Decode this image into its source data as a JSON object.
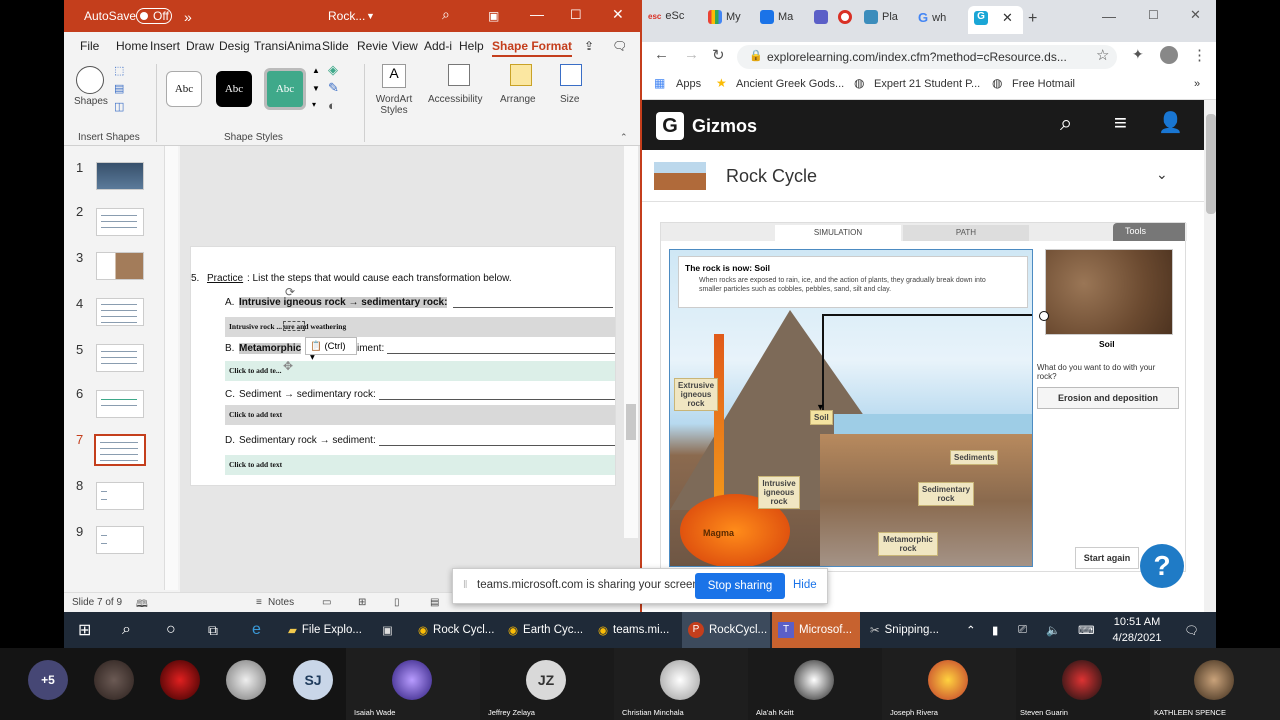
{
  "ppt": {
    "autosave": "AutoSave",
    "autosave_state": "Off",
    "title": "Rock...",
    "tabs": [
      "File",
      "Home",
      "Insert",
      "Draw",
      "Desig",
      "Transi",
      "Anima",
      "Slide",
      "Revie",
      "View",
      "Add-i",
      "Help",
      "Shape Format"
    ],
    "ribbon": {
      "shapes": "Shapes",
      "insert_shapes": "Insert Shapes",
      "style_text": "Abc",
      "shape_styles": "Shape Styles",
      "wordart": "WordArt Styles",
      "accessibility": "Accessibility",
      "arrange": "Arrange",
      "size": "Size"
    },
    "slide_numbers": [
      "1",
      "2",
      "3",
      "4",
      "5",
      "6",
      "7",
      "8",
      "9"
    ],
    "slide": {
      "practice_num": "5.",
      "practice_label": "Practice",
      "practice_text": ": List the steps that would cause each transformation below.",
      "items": [
        {
          "letter": "A.",
          "text": "Intrusive igneous rock → sedimentary rock:",
          "answer": "Intrusive rock ... ure and weathering"
        },
        {
          "letter": "B.",
          "text": "Metamorphic",
          "text2": "iment:",
          "answer": "Click to add te..."
        },
        {
          "letter": "C.",
          "text": "Sediment → sedimentary rock:",
          "answer": "Click to add text"
        },
        {
          "letter": "D.",
          "text": "Sedimentary rock → sediment:",
          "answer": "Click to add text"
        }
      ],
      "paste_hint": "(Ctrl)"
    },
    "status": {
      "slide": "Slide 7 of 9",
      "notes": "Notes"
    }
  },
  "chrome": {
    "tabs": [
      {
        "label": "eSc",
        "color": "#d93025"
      },
      {
        "label": "My",
        "color": "#ea4335"
      },
      {
        "label": "Ma",
        "color": "#1a73e8"
      },
      {
        "label": "",
        "color": "#5b5fc7"
      },
      {
        "label": "",
        "color": "#d93025"
      },
      {
        "label": "Pla",
        "color": "#3c8dbc"
      },
      {
        "label": "wh",
        "color": "#4285f4"
      },
      {
        "label": "",
        "color": "#1aa6d6"
      }
    ],
    "url": "explorelearning.com/index.cfm?method=cResource.ds...",
    "bookmarks": [
      "Apps",
      "Ancient Greek Gods...",
      "Expert 21 Student P...",
      "Free Hotmail"
    ]
  },
  "gizmo": {
    "brand": "Gizmos",
    "title": "Rock Cycle",
    "tabs": [
      "SIMULATION",
      "PATH",
      "Tools"
    ],
    "info_title": "The rock is now: Soil",
    "info_text": "When rocks are exposed to rain, ice, and the action of plants, they gradually break down into smaller particles such as cobbles, pebbles, sand, silt and clay.",
    "labels": {
      "extrusive": "Extrusive igneous rock",
      "soil": "Soil",
      "sediments": "Sediments",
      "sedimentary": "Sedimentary rock",
      "intrusive": "Intrusive igneous rock",
      "magma": "Magma",
      "metamorphic": "Metamorphic rock"
    },
    "soil_caption": "Soil",
    "question": "What do you want to do with your rock?",
    "action_button": "Erosion and deposition",
    "start_again": "Start again"
  },
  "share": {
    "message": "teams.microsoft.com is sharing your screen.",
    "stop": "Stop sharing",
    "hide": "Hide"
  },
  "taskbar": {
    "items": [
      "File Explo...",
      "Rock Cycl...",
      "Earth Cyc...",
      "teams.mi...",
      "RockCycl...",
      "Microsof...",
      "Snipping..."
    ],
    "time": "10:51 AM",
    "date": "4/28/2021"
  },
  "teams": {
    "overflow": "+5",
    "participants": [
      "Isaiah Wade",
      "Jeffrey Zelaya",
      "Christian Minchala",
      "Ala'ah Keitt",
      "Joseph Rivera",
      "Steven Guarin",
      "KATHLEEN SPENCE"
    ],
    "initials": [
      "SJ",
      "JZ"
    ]
  }
}
